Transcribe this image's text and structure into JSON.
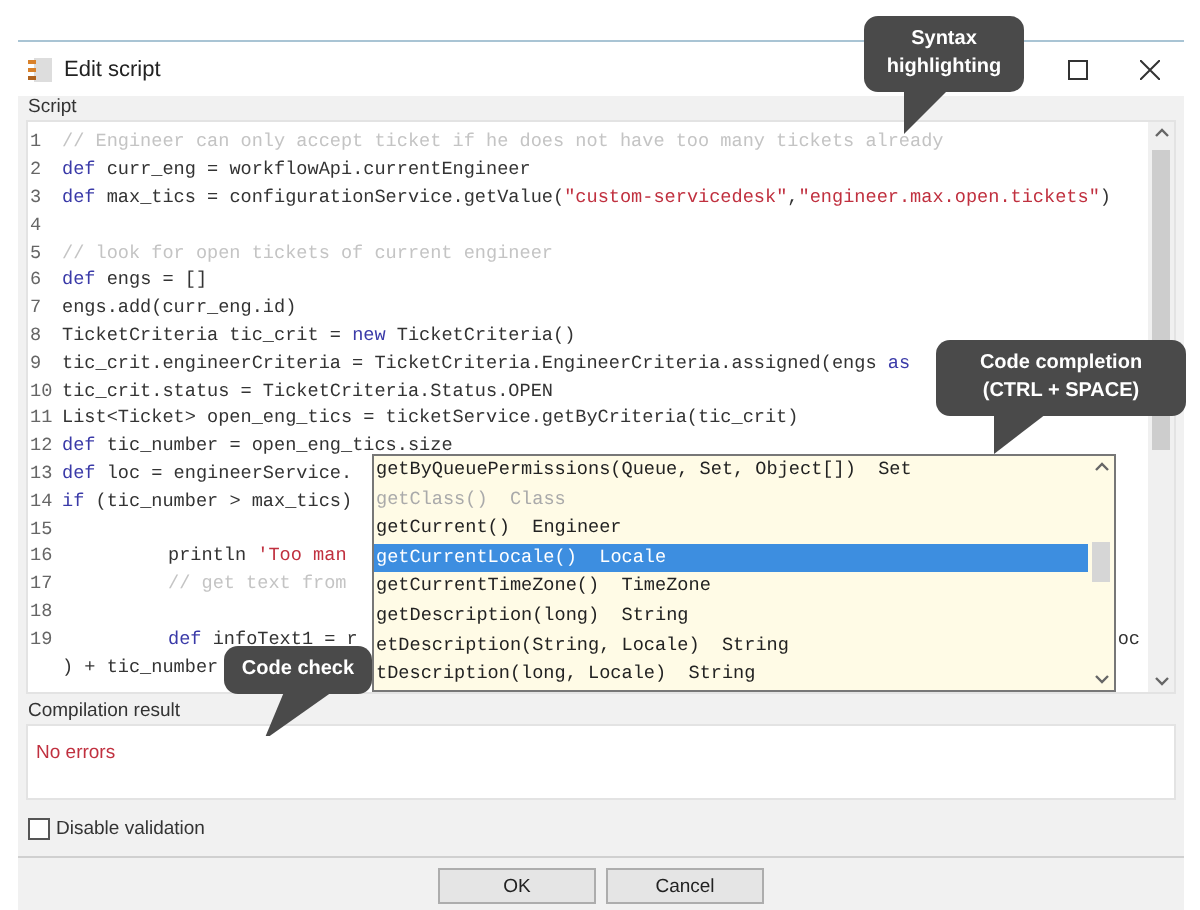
{
  "window": {
    "title": "Edit script"
  },
  "script": {
    "label": "Script",
    "lines": [
      {
        "number": "1",
        "segments": [
          {
            "kind": "comment",
            "text": "// Engineer can only accept ticket if he does not have too many tickets already"
          }
        ]
      },
      {
        "number": "2",
        "segments": [
          {
            "kind": "kw",
            "text": "def"
          },
          {
            "kind": "plain",
            "text": " curr_eng = workflowApi.currentEngineer"
          }
        ]
      },
      {
        "number": "3",
        "segments": [
          {
            "kind": "kw",
            "text": "def"
          },
          {
            "kind": "plain",
            "text": " max_tics = configurationService.getValue("
          },
          {
            "kind": "str",
            "text": "\"custom-servicedesk\""
          },
          {
            "kind": "plain",
            "text": ","
          },
          {
            "kind": "str",
            "text": "\"engineer.max.open.tickets\""
          },
          {
            "kind": "plain",
            "text": ")"
          }
        ]
      },
      {
        "number": "4"
      },
      {
        "number": "5",
        "segments": [
          {
            "kind": "comment",
            "text": "// look for open tickets of current engineer"
          }
        ]
      },
      {
        "number": "6",
        "segments": [
          {
            "kind": "kw",
            "text": "def"
          },
          {
            "kind": "plain",
            "text": " engs = []"
          }
        ]
      },
      {
        "number": "7",
        "segments": [
          {
            "kind": "plain",
            "text": "engs.add(curr_eng.id)"
          }
        ]
      },
      {
        "number": "8",
        "segments": [
          {
            "kind": "plain",
            "text": "TicketCriteria tic_crit = "
          },
          {
            "kind": "kw",
            "text": "new"
          },
          {
            "kind": "plain",
            "text": " TicketCriteria()"
          }
        ]
      },
      {
        "number": "9",
        "segments": [
          {
            "kind": "plain",
            "text": "tic_crit.engineerCriteria = TicketCriteria.EngineerCriteria.assigned(engs "
          },
          {
            "kind": "kw",
            "text": "as"
          }
        ]
      },
      {
        "number": "10",
        "segments": [
          {
            "kind": "plain",
            "text": "tic_crit.status = TicketCriteria.Status.OPEN"
          }
        ]
      },
      {
        "number": "11",
        "segments": [
          {
            "kind": "plain",
            "text": "List<Ticket> open_eng_tics = ticketService.getByCriteria(tic_crit)"
          }
        ]
      },
      {
        "number": "12",
        "segments": [
          {
            "kind": "kw",
            "text": "def"
          },
          {
            "kind": "plain",
            "text": " tic_number = open_eng_tics.size"
          }
        ]
      },
      {
        "number": "13",
        "segments": [
          {
            "kind": "kw",
            "text": "def"
          },
          {
            "kind": "plain",
            "text": " loc = engineerService."
          }
        ]
      },
      {
        "number": "14",
        "segments": [
          {
            "kind": "kw",
            "text": "if"
          },
          {
            "kind": "plain",
            "text": " (tic_number > max_tics)"
          }
        ]
      },
      {
        "number": "15"
      },
      {
        "number": "16",
        "indented": true,
        "segments": [
          {
            "kind": "plain",
            "text": "println "
          },
          {
            "kind": "str",
            "text": "'Too man"
          }
        ]
      },
      {
        "number": "17",
        "indented": true,
        "segments": [
          {
            "kind": "comment",
            "text": "// get text from"
          }
        ]
      },
      {
        "number": "18"
      },
      {
        "number": "19",
        "indented": true,
        "segments": [
          {
            "kind": "kw",
            "text": "def"
          },
          {
            "kind": "plain",
            "text": " infoText1 = r"
          }
        ],
        "tail": "oc"
      },
      {
        "segments": [
          {
            "kind": "plain",
            "text": ") + tic_number"
          }
        ]
      }
    ]
  },
  "completion": {
    "items": [
      {
        "name": "getByQueuePermissions(Queue, Set, Object[])",
        "type": "Set",
        "disabled": false,
        "selected": false
      },
      {
        "name": "getClass()",
        "type": "Class",
        "disabled": true,
        "selected": false
      },
      {
        "name": "getCurrent()",
        "type": "Engineer",
        "disabled": false,
        "selected": false
      },
      {
        "name": "getCurrentLocale()",
        "type": "Locale",
        "disabled": false,
        "selected": true
      },
      {
        "name": "getCurrentTimeZone()",
        "type": "TimeZone",
        "disabled": false,
        "selected": false
      },
      {
        "name": "getDescription(long)",
        "type": "String",
        "disabled": false,
        "selected": false
      },
      {
        "name": "etDescription(String, Locale)",
        "type": "String",
        "disabled": false,
        "selected": false
      },
      {
        "name": "tDescription(long, Locale)",
        "type": "String",
        "disabled": false,
        "selected": false
      }
    ]
  },
  "compilation": {
    "label": "Compilation result",
    "message": "No errors"
  },
  "disable_validation": {
    "label": "Disable validation",
    "checked": false
  },
  "buttons": [
    "OK",
    "Cancel"
  ],
  "callouts": [
    "Syntax highlighting",
    "Code completion (CTRL + SPACE)",
    "Code check"
  ]
}
